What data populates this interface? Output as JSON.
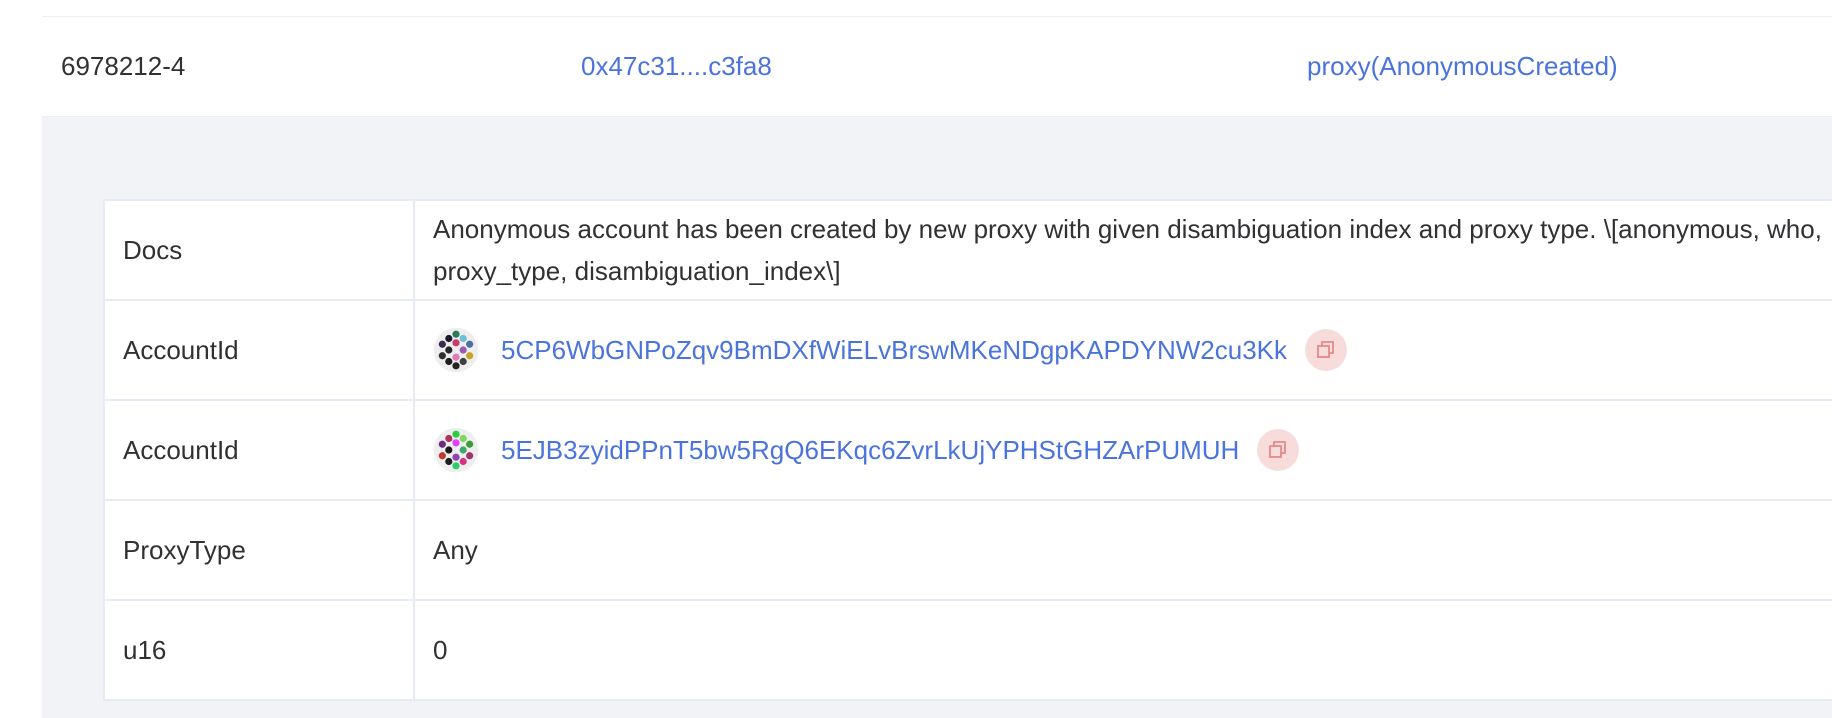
{
  "event": {
    "id": "6978212-4",
    "hash": "0x47c31....c3fa8",
    "name": "proxy(AnonymousCreated)"
  },
  "params": {
    "docs": {
      "key": "Docs",
      "value": "Anonymous account has been created by new proxy with given disambiguation index and proxy type. \\[anonymous, who, proxy_type, disambiguation_index\\]"
    },
    "account1": {
      "key": "AccountId",
      "value": "5CP6WbGNPoZqv9BmDXfWiELvBrswMKeNDgpKAPDYNW2cu3Kk"
    },
    "account2": {
      "key": "AccountId",
      "value": "5EJB3zyidPPnT5bw5RgQ6EKqc6ZvrLkUjYPHStGHZArPUMUH"
    },
    "proxy_type": {
      "key": "ProxyType",
      "value": "Any"
    },
    "u16": {
      "key": "u16",
      "value": "0"
    }
  },
  "icons": {
    "copy": "copy-icon",
    "identicon": "polkadot-identicon"
  },
  "colors": {
    "link": "#4a74dc",
    "copy_bg": "#f8dcdc",
    "copy_fg": "#e48a8a",
    "panel_bg": "#f2f3f7"
  }
}
